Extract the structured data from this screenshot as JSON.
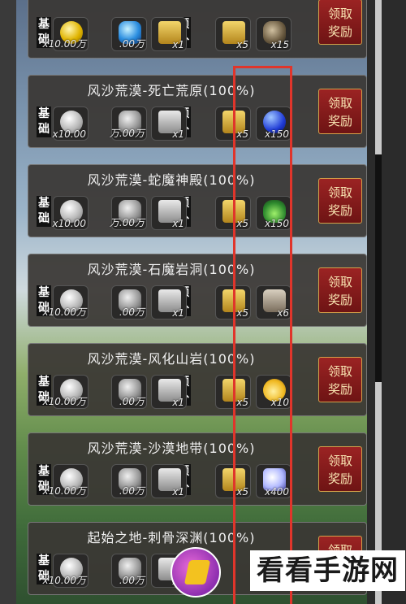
{
  "rewards": [
    {
      "title": "",
      "progress": "",
      "base_label_1": "基",
      "base_label_2": "础",
      "extra_label_1": "额",
      "extra_label_2": "外",
      "base_items": [
        {
          "icon": "gold-coin-icon",
          "style": "coin",
          "qty": "x10.00万"
        },
        {
          "icon": "blue-gem-icon",
          "style": "gem",
          "qty": ".00万"
        },
        {
          "icon": "gold-chest-icon",
          "style": "chest",
          "qty": "x1"
        }
      ],
      "extra_items": [
        {
          "icon": "gold-chest-icon",
          "style": "chest",
          "qty": "x5"
        },
        {
          "icon": "ore-icon",
          "style": "ore",
          "qty": "x15"
        }
      ],
      "button": {
        "line1": "领取",
        "line2": "奖励"
      }
    },
    {
      "title": "风沙荒漠-死亡荒原",
      "progress": "(100%)",
      "base_label_1": "基",
      "base_label_2": "础",
      "extra_label_1": "额",
      "extra_label_2": "外",
      "base_items": [
        {
          "icon": "silver-coin-icon",
          "style": "coin grey",
          "qty": "x10.00"
        },
        {
          "icon": "grey-gem-icon",
          "style": "gem grey",
          "qty": "万.00万"
        },
        {
          "icon": "grey-chest-icon",
          "style": "chest grey",
          "qty": "x1"
        }
      ],
      "extra_items": [
        {
          "icon": "gold-chest-icon",
          "style": "chest",
          "qty": "x5"
        },
        {
          "icon": "blue-orb-icon",
          "style": "orb",
          "qty": "x150"
        }
      ],
      "button": {
        "line1": "领取",
        "line2": "奖励"
      }
    },
    {
      "title": "风沙荒漠-蛇魔神殿",
      "progress": "(100%)",
      "base_label_1": "基",
      "base_label_2": "础",
      "extra_label_1": "额",
      "extra_label_2": "外",
      "base_items": [
        {
          "icon": "silver-coin-icon",
          "style": "coin grey",
          "qty": "x10.00"
        },
        {
          "icon": "grey-gem-icon",
          "style": "gem grey",
          "qty": "万.00万"
        },
        {
          "icon": "grey-chest-icon",
          "style": "chest grey",
          "qty": "x1"
        }
      ],
      "extra_items": [
        {
          "icon": "gold-chest-icon",
          "style": "chest",
          "qty": "x5"
        },
        {
          "icon": "green-herb-icon",
          "style": "herb",
          "qty": "x150"
        }
      ],
      "button": {
        "line1": "领取",
        "line2": "奖励"
      }
    },
    {
      "title": "风沙荒漠-石魔岩洞",
      "progress": "(100%)",
      "base_label_1": "基",
      "base_label_2": "础",
      "extra_label_1": "额",
      "extra_label_2": "外",
      "base_items": [
        {
          "icon": "silver-coin-icon",
          "style": "coin grey",
          "qty": "x10.00万"
        },
        {
          "icon": "grey-gem-icon",
          "style": "gem grey",
          "qty": ".00万"
        },
        {
          "icon": "grey-chest-icon",
          "style": "chest grey",
          "qty": "x1"
        }
      ],
      "extra_items": [
        {
          "icon": "gold-chest-icon",
          "style": "chest",
          "qty": "x5"
        },
        {
          "icon": "hourglass-icon",
          "style": "hourglass",
          "qty": "x6"
        }
      ],
      "button": {
        "line1": "领取",
        "line2": "奖励"
      }
    },
    {
      "title": "风沙荒漠-风化山岩",
      "progress": "(100%)",
      "base_label_1": "基",
      "base_label_2": "础",
      "extra_label_1": "额",
      "extra_label_2": "外",
      "base_items": [
        {
          "icon": "silver-coin-icon",
          "style": "coin grey",
          "qty": "x10.00万"
        },
        {
          "icon": "grey-gem-icon",
          "style": "gem grey",
          "qty": ".00万"
        },
        {
          "icon": "grey-chest-icon",
          "style": "chest grey",
          "qty": "x1"
        }
      ],
      "extra_items": [
        {
          "icon": "gold-chest-icon",
          "style": "chest",
          "qty": "x5"
        },
        {
          "icon": "yellow-potion-icon",
          "style": "potion",
          "qty": "x10"
        }
      ],
      "button": {
        "line1": "领取",
        "line2": "奖励"
      }
    },
    {
      "title": "风沙荒漠-沙漠地带",
      "progress": "(100%)",
      "base_label_1": "基",
      "base_label_2": "础",
      "extra_label_1": "额",
      "extra_label_2": "外",
      "base_items": [
        {
          "icon": "silver-coin-icon",
          "style": "coin grey",
          "qty": "x10.00万"
        },
        {
          "icon": "grey-gem-icon",
          "style": "gem grey",
          "qty": ".00万"
        },
        {
          "icon": "grey-chest-icon",
          "style": "chest grey",
          "qty": "x1"
        }
      ],
      "extra_items": [
        {
          "icon": "gold-chest-icon",
          "style": "chest",
          "qty": "x5"
        },
        {
          "icon": "crystal-icon",
          "style": "crystal",
          "qty": "x400"
        }
      ],
      "button": {
        "line1": "领取",
        "line2": "奖励"
      }
    },
    {
      "title": "起始之地-刺骨深渊",
      "progress": "(100%)",
      "base_label_1": "基",
      "base_label_2": "础",
      "extra_label_1": "额",
      "extra_label_2": "",
      "base_items": [
        {
          "icon": "silver-coin-icon",
          "style": "coin grey",
          "qty": "x10.00万"
        },
        {
          "icon": "grey-gem-icon",
          "style": "gem grey",
          "qty": ".00万"
        },
        {
          "icon": "grey-chest-icon",
          "style": "chest grey",
          "qty": "x1"
        }
      ],
      "extra_items": [],
      "button": {
        "line1": "领取",
        "line2": "奖励"
      }
    }
  ],
  "watermark": {
    "text": "看看手游网"
  },
  "colors": {
    "highlight_box": "#e0352b",
    "button_red": "#8a1d1d",
    "button_border": "#d4a24a"
  }
}
